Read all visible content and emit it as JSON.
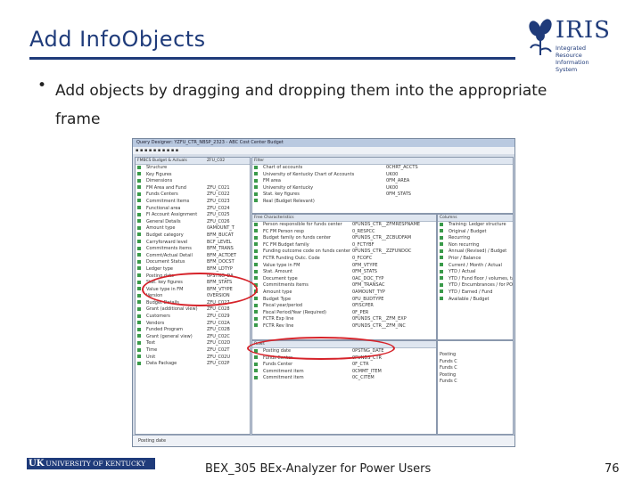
{
  "slide": {
    "title": "Add InfoObjects",
    "bullet": "Add objects by dragging and dropping them into the appropriate frame"
  },
  "logo": {
    "name": "IRIS",
    "subtitle": "Integrated Resource Information System"
  },
  "footer": {
    "university": "UNIVERSITY OF KENTUCKY",
    "uk": "UK",
    "course": "BEX_305 BEx-Analyzer for Power Users",
    "page_number": "76"
  },
  "screenshot": {
    "window_title": "Query Designer: YZFU_CTR_NBSP_2323 - ABC Cost Center Budget",
    "infoprovider_header": [
      "FMBCS Budget & Actuals",
      "ZFU_C02"
    ],
    "infoprovider_rows": [
      [
        "Structure",
        ""
      ],
      [
        "Key Figures",
        ""
      ],
      [
        "Dimensions",
        ""
      ],
      [
        "FM Area and Fund",
        "ZFU_C021"
      ],
      [
        "Funds Centers",
        "ZFU_C022"
      ],
      [
        "Commitment Items",
        "ZFU_C023"
      ],
      [
        "Functional area",
        "ZFU_C024"
      ],
      [
        "FI Account Assignment",
        "ZFU_C025"
      ],
      [
        "General Details",
        "ZFU_C026"
      ],
      [
        "Amount type",
        "0AMOUNT_T"
      ],
      [
        "Budget category",
        "BFM_BUCAT"
      ],
      [
        "Carryforward level",
        "BCF_LEVEL"
      ],
      [
        "Commitments items",
        "BFM_TRANS"
      ],
      [
        "Commt/Actual Detail",
        "BFM_ACTDET"
      ],
      [
        "Document Status",
        "BFM_DOCST"
      ],
      [
        "Ledger type",
        "BFM_LDTYP"
      ],
      [
        "Posting date",
        "0PSTNG_DA"
      ],
      [
        "Stat. key figures",
        "BFM_STATS"
      ],
      [
        "Value type in FM",
        "BFM_VTYPE"
      ],
      [
        "Version",
        "0VERSION"
      ],
      [
        "Budget Details",
        "ZFU_C027"
      ],
      [
        "Grant (additional view)",
        "ZFU_C028"
      ],
      [
        "Customers",
        "ZFU_C029"
      ],
      [
        "Vendors",
        "ZFU_C02A"
      ],
      [
        "Funded Program",
        "ZFU_C02B"
      ],
      [
        "Grant (general view)",
        "ZFU_C02C"
      ],
      [
        "Text",
        "ZFU_C02D"
      ],
      [
        "Time",
        "ZFU_C02T"
      ],
      [
        "Unit",
        "ZFU_C02U"
      ],
      [
        "Data Package",
        "ZFU_C02P"
      ]
    ],
    "filter_header": "Filter",
    "filter_rows": [
      [
        "Chart of accounts",
        "0CHRT_ACCTS"
      ],
      [
        "University of Kentucky Chart of Accounts",
        "UK00"
      ],
      [
        "FM area",
        "0FM_AREA"
      ],
      [
        "University of Kentucky",
        "UK00"
      ],
      [
        "Stat. key figures",
        "0FM_STATS"
      ],
      [
        "Real (Budget Relevant)",
        ""
      ]
    ],
    "free_header": "Free Characteristics",
    "free_rows": [
      [
        "Person responsible for funds center",
        "0FUNDS_CTR__ZFMRESPNAME"
      ],
      [
        "FC FM Person resp",
        "0_RESPCC"
      ],
      [
        "Budget family on funds center",
        "0FUNDS_CTR__ZCBUDFAM"
      ],
      [
        "FC FM Budget family",
        "0_FCTYBF"
      ],
      [
        "Funding outcome code on funds center",
        "0FUNDS_CTR__ZZFUNDOC"
      ],
      [
        "FCTR Funding Outc. Code",
        "0_FCOFC"
      ],
      [
        "Value type in FM",
        "0FM_VTYPE"
      ],
      [
        "Stat. Amount",
        "0FM_STATS"
      ],
      [
        "Document type",
        "0AC_DOC_TYP"
      ],
      [
        "Commitments items",
        "0FM_TRANSAC"
      ],
      [
        "Amount type",
        "0AMOUNT_TYP"
      ],
      [
        "Budget Type",
        "0FU_BUDTYPE"
      ],
      [
        "Fiscal year/period",
        "0FISCPER"
      ],
      [
        "Fiscal Period/Year (Required)",
        "0F_PER"
      ],
      [
        "FCTR Exp line",
        "0FUNDS_CTR__ZFM_EXP"
      ],
      [
        "FCTR Rev line",
        "0FUNDS_CTR__ZFM_INC"
      ]
    ],
    "rows_header": "Rows",
    "rows_rows": [
      [
        "Posting date",
        "0PSTNG_DATE"
      ],
      [
        "Funds Center",
        "0FUNDS_CTR"
      ],
      [
        "Funds Center",
        "0F_CTR"
      ],
      [
        "Commitment item",
        "0CMMT_ITEM"
      ],
      [
        "Commitment item",
        "0C_CITEM"
      ]
    ],
    "columns_header": "Columns",
    "columns_rows": [
      "Training: Ledger structure",
      "Original / Budget",
      "Recurring",
      "Non recurring",
      "Annual (Revised) / Budget",
      "Prior / Balance",
      "Current / Month / Actual",
      "YTD / Actual",
      "YTD / Fund floor / volumes, tags",
      "YTD / Encumbrances / for PO's",
      "YTD / Earned / Fund",
      "Available / Budget"
    ],
    "preview_rows": [
      "Posting",
      "Funds C",
      "Funds C",
      "Posting",
      "Funds C"
    ],
    "status_text": "Posting date"
  }
}
